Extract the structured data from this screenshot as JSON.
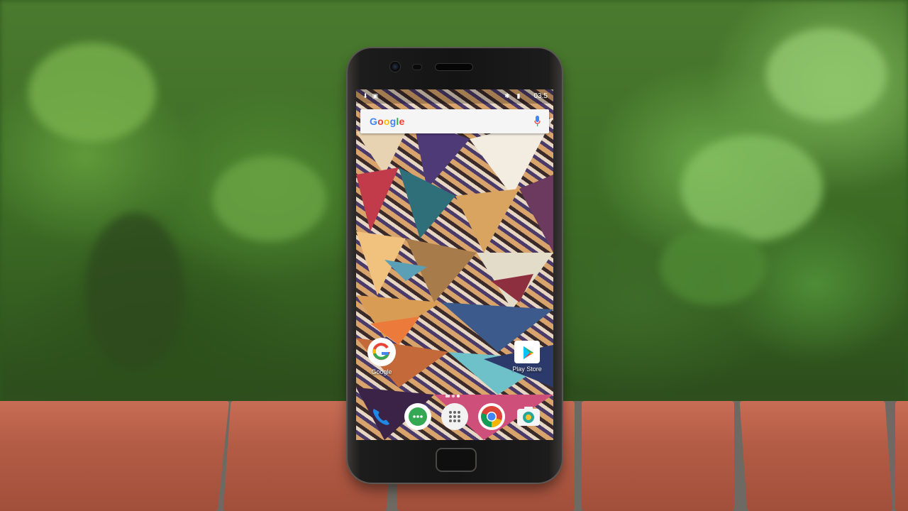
{
  "scene": {
    "description_hidden": "",
    "colors": {
      "foliage": "#4a7a2e",
      "brick": "#b35c45",
      "phone_body": "#141414"
    }
  },
  "phone": {
    "status_bar": {
      "time": "03:5",
      "icons": [
        "download-icon",
        "lock-icon",
        "bluetooth-icon",
        "battery-icon"
      ]
    },
    "search_widget": {
      "logo_text": "Google",
      "mic_icon": "mic-icon"
    },
    "home_apps": [
      {
        "label": "Google",
        "icon": "google-app-icon"
      },
      {
        "label": "Play Store",
        "icon": "play-store-icon"
      }
    ],
    "page_indicator": {
      "pages": 2,
      "current": 2
    },
    "dock": [
      {
        "icon": "phone-icon"
      },
      {
        "icon": "messages-icon"
      },
      {
        "icon": "app-drawer-icon"
      },
      {
        "icon": "chrome-icon"
      },
      {
        "icon": "camera-icon"
      }
    ]
  }
}
